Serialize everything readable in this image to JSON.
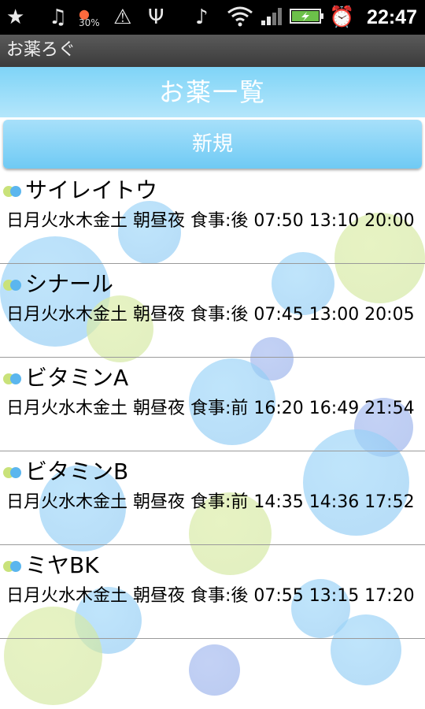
{
  "status_bar": {
    "battery_label": "30%",
    "time": "22:47",
    "icons": [
      "star-icon",
      "music-icon",
      "battery-saver-icon",
      "warning-icon",
      "usb-icon",
      "no-music-icon",
      "wifi-icon",
      "signal-icon",
      "battery-icon",
      "alarm-icon"
    ]
  },
  "app": {
    "title": "お薬ろぐ"
  },
  "header": {
    "title": "お薬一覧"
  },
  "new_button": {
    "label": "新規"
  },
  "medications": [
    {
      "name": "サイレイトウ",
      "schedule": "日月火水木金土 朝昼夜 食事:後 07:50 13:10 20:00"
    },
    {
      "name": "シナール",
      "schedule": "日月火水木金土 朝昼夜 食事:後 07:45 13:00 20:05"
    },
    {
      "name": "ビタミンA",
      "schedule": "日月火水木金土 朝昼夜 食事:前 16:20 16:49 21:54"
    },
    {
      "name": "ビタミンB",
      "schedule": "日月火水木金土 朝昼夜 食事:前 14:35 14:36 17:52"
    },
    {
      "name": "ミヤBK",
      "schedule": "日月火水木金土 朝昼夜 食事:後 07:55 13:15 17:20"
    }
  ],
  "colors": {
    "header_bg": "#9fdcf8",
    "accent": "#6fcaf4",
    "pill_green": "#c9e27a",
    "pill_blue": "#5bb6ee"
  }
}
